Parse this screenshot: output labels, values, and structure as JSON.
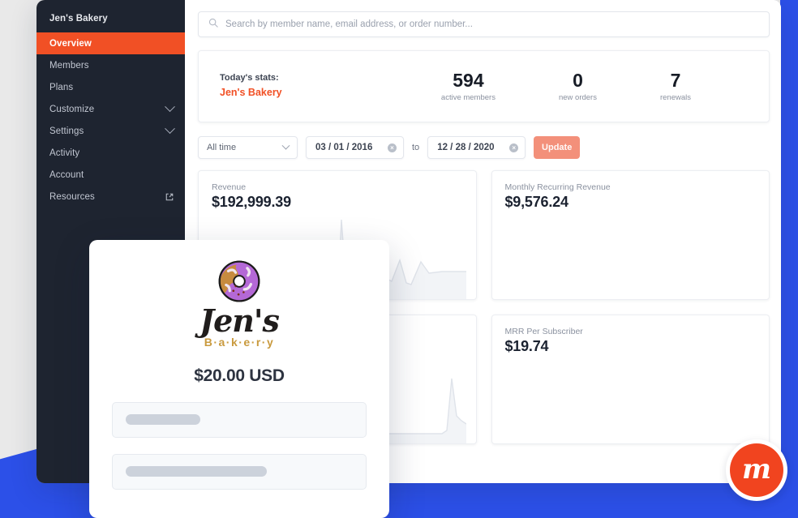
{
  "theme": {
    "accent_orange": "#f15025",
    "brand_blue": "#2c50e8",
    "sidebar_bg": "#1e2430",
    "badge_red": "#f1441f",
    "page_bg": "#e9e9e9"
  },
  "sidebar": {
    "brand": "Jen's Bakery",
    "items": [
      {
        "label": "Overview",
        "active": true,
        "chevron": false,
        "external": false
      },
      {
        "label": "Members",
        "active": false,
        "chevron": false,
        "external": false
      },
      {
        "label": "Plans",
        "active": false,
        "chevron": false,
        "external": false
      },
      {
        "label": "Customize",
        "active": false,
        "chevron": true,
        "external": false
      },
      {
        "label": "Settings",
        "active": false,
        "chevron": true,
        "external": false
      },
      {
        "label": "Activity",
        "active": false,
        "chevron": false,
        "external": false
      },
      {
        "label": "Account",
        "active": false,
        "chevron": false,
        "external": false
      },
      {
        "label": "Resources",
        "active": false,
        "chevron": false,
        "external": true
      }
    ]
  },
  "search": {
    "placeholder": "Search by member name, email address, or order number...",
    "value": "",
    "icon": "search-icon"
  },
  "stats": {
    "heading": "Today's stats:",
    "store": "Jen's Bakery",
    "items": [
      {
        "value": "594",
        "label": "active members"
      },
      {
        "value": "0",
        "label": "new orders"
      },
      {
        "value": "7",
        "label": "renewals"
      }
    ]
  },
  "filters": {
    "range_select": "All time",
    "date_from": "03 / 01 / 2016",
    "date_to": "12 / 28 / 2020",
    "to_label": "to",
    "clear_glyph": "×",
    "update_label": "Update"
  },
  "metrics": [
    {
      "label": "Revenue",
      "value": "$192,999.39",
      "has_sparkline": true
    },
    {
      "label": "Monthly Recurring Revenue",
      "value": "$9,576.24",
      "has_sparkline": false
    },
    {
      "label": "",
      "value": "",
      "has_sparkline": true
    },
    {
      "label": "MRR Per Subscriber",
      "value": "$19.74",
      "has_sparkline": false
    }
  ],
  "chart_data": {
    "type": "area",
    "title": "Revenue sparkline",
    "xlabel": "",
    "ylabel": "",
    "grid": false,
    "legend": "none",
    "series": [
      {
        "name": "Revenue",
        "x": [
          0,
          1,
          2,
          3,
          4,
          5,
          6,
          7,
          8,
          9,
          10,
          11,
          12,
          13,
          14,
          15,
          16,
          17,
          18,
          19,
          20,
          21
        ],
        "values": [
          2,
          4,
          98,
          30,
          28,
          12,
          6,
          4,
          6,
          8,
          10,
          38,
          18,
          14,
          34,
          12,
          10,
          34,
          26,
          28,
          28,
          28
        ]
      }
    ],
    "ylim": [
      0,
      100
    ]
  },
  "checkout": {
    "logo_icon": "donut-icon",
    "logo_primary": "Jen's",
    "logo_secondary": "B·a·k·e·r·y",
    "price": "$20.00 USD",
    "fields": [
      {
        "name": "field-one",
        "skeleton_width": "33%"
      },
      {
        "name": "field-two",
        "skeleton_width": "62%"
      }
    ]
  },
  "badge": {
    "letter": "m",
    "name": "memberful-logo"
  }
}
